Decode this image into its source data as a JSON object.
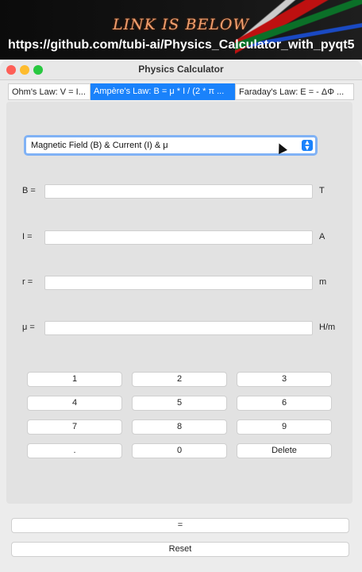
{
  "banner": {
    "headline": "LINK IS BELOW",
    "url": "https://github.com/tubi-ai/Physics_Calculator_with_pyqt5"
  },
  "window": {
    "title": "Physics Calculator"
  },
  "tabs": [
    {
      "label": "Ohm's Law: V = I..."
    },
    {
      "label": "Ampère's Law: B = μ * I / (2 * π ..."
    },
    {
      "label": "Faraday's Law: E = - ΔΦ ..."
    }
  ],
  "mode_select": {
    "value": "Magnetic Field (B) & Current (I) & μ"
  },
  "fields": [
    {
      "label": "B =",
      "value": "",
      "unit": "T"
    },
    {
      "label": "I =",
      "value": "",
      "unit": "A"
    },
    {
      "label": "r =",
      "value": "",
      "unit": "m"
    },
    {
      "label": "μ =",
      "value": "",
      "unit": "H/m"
    }
  ],
  "keypad": [
    "1",
    "2",
    "3",
    "4",
    "5",
    "6",
    "7",
    "8",
    "9",
    ".",
    "0",
    "Delete"
  ],
  "equals_label": "=",
  "reset_label": "Reset"
}
